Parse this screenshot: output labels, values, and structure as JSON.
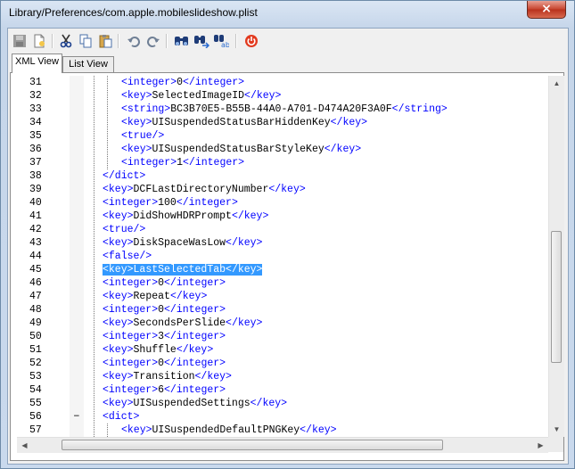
{
  "window": {
    "title": "Library/Preferences/com.apple.mobileslideshow.plist",
    "close_glyph": "×"
  },
  "toolbar": {
    "icons": [
      "save-icon",
      "new-document-icon",
      "cut-icon",
      "copy-icon",
      "paste-icon",
      "undo-icon",
      "redo-icon",
      "find-icon",
      "find-next-icon",
      "replace-icon",
      "power-icon"
    ]
  },
  "tabs": [
    {
      "label": "XML View",
      "active": true
    },
    {
      "label": "List View",
      "active": false
    }
  ],
  "editor": {
    "selected_line": 45,
    "lines": [
      {
        "n": "31",
        "indent": 2,
        "parts": [
          [
            "tag",
            "<integer>"
          ],
          [
            "txt",
            "0"
          ],
          [
            "tag",
            "</integer>"
          ]
        ]
      },
      {
        "n": "32",
        "indent": 2,
        "parts": [
          [
            "tag",
            "<key>"
          ],
          [
            "txt",
            "SelectedImageID"
          ],
          [
            "tag",
            "</key>"
          ]
        ]
      },
      {
        "n": "33",
        "indent": 2,
        "parts": [
          [
            "tag",
            "<string>"
          ],
          [
            "txt",
            "BC3B70E5-B55B-44A0-A701-D474A20F3A0F"
          ],
          [
            "tag",
            "</string>"
          ]
        ]
      },
      {
        "n": "34",
        "indent": 2,
        "parts": [
          [
            "tag",
            "<key>"
          ],
          [
            "txt",
            "UISuspendedStatusBarHiddenKey"
          ],
          [
            "tag",
            "</key>"
          ]
        ]
      },
      {
        "n": "35",
        "indent": 2,
        "parts": [
          [
            "tag",
            "<true/>"
          ]
        ]
      },
      {
        "n": "36",
        "indent": 2,
        "parts": [
          [
            "tag",
            "<key>"
          ],
          [
            "txt",
            "UISuspendedStatusBarStyleKey"
          ],
          [
            "tag",
            "</key>"
          ]
        ]
      },
      {
        "n": "37",
        "indent": 2,
        "parts": [
          [
            "tag",
            "<integer>"
          ],
          [
            "txt",
            "1"
          ],
          [
            "tag",
            "</integer>"
          ]
        ]
      },
      {
        "n": "38",
        "indent": 1,
        "parts": [
          [
            "tag",
            "</dict>"
          ]
        ]
      },
      {
        "n": "39",
        "indent": 1,
        "parts": [
          [
            "tag",
            "<key>"
          ],
          [
            "txt",
            "DCFLastDirectoryNumber"
          ],
          [
            "tag",
            "</key>"
          ]
        ]
      },
      {
        "n": "40",
        "indent": 1,
        "parts": [
          [
            "tag",
            "<integer>"
          ],
          [
            "txt",
            "100"
          ],
          [
            "tag",
            "</integer>"
          ]
        ]
      },
      {
        "n": "41",
        "indent": 1,
        "parts": [
          [
            "tag",
            "<key>"
          ],
          [
            "txt",
            "DidShowHDRPrompt"
          ],
          [
            "tag",
            "</key>"
          ]
        ]
      },
      {
        "n": "42",
        "indent": 1,
        "parts": [
          [
            "tag",
            "<true/>"
          ]
        ]
      },
      {
        "n": "43",
        "indent": 1,
        "parts": [
          [
            "tag",
            "<key>"
          ],
          [
            "txt",
            "DiskSpaceWasLow"
          ],
          [
            "tag",
            "</key>"
          ]
        ]
      },
      {
        "n": "44",
        "indent": 1,
        "parts": [
          [
            "tag",
            "<false/>"
          ]
        ]
      },
      {
        "n": "45",
        "indent": 1,
        "parts": [
          [
            "tag",
            "<key>"
          ],
          [
            "txt",
            "LastSelectedTab"
          ],
          [
            "tag",
            "</key>"
          ]
        ]
      },
      {
        "n": "46",
        "indent": 1,
        "parts": [
          [
            "tag",
            "<integer>"
          ],
          [
            "txt",
            "0"
          ],
          [
            "tag",
            "</integer>"
          ]
        ]
      },
      {
        "n": "47",
        "indent": 1,
        "parts": [
          [
            "tag",
            "<key>"
          ],
          [
            "txt",
            "Repeat"
          ],
          [
            "tag",
            "</key>"
          ]
        ]
      },
      {
        "n": "48",
        "indent": 1,
        "parts": [
          [
            "tag",
            "<integer>"
          ],
          [
            "txt",
            "0"
          ],
          [
            "tag",
            "</integer>"
          ]
        ]
      },
      {
        "n": "49",
        "indent": 1,
        "parts": [
          [
            "tag",
            "<key>"
          ],
          [
            "txt",
            "SecondsPerSlide"
          ],
          [
            "tag",
            "</key>"
          ]
        ]
      },
      {
        "n": "50",
        "indent": 1,
        "parts": [
          [
            "tag",
            "<integer>"
          ],
          [
            "txt",
            "3"
          ],
          [
            "tag",
            "</integer>"
          ]
        ]
      },
      {
        "n": "51",
        "indent": 1,
        "parts": [
          [
            "tag",
            "<key>"
          ],
          [
            "txt",
            "Shuffle"
          ],
          [
            "tag",
            "</key>"
          ]
        ]
      },
      {
        "n": "52",
        "indent": 1,
        "parts": [
          [
            "tag",
            "<integer>"
          ],
          [
            "txt",
            "0"
          ],
          [
            "tag",
            "</integer>"
          ]
        ]
      },
      {
        "n": "53",
        "indent": 1,
        "parts": [
          [
            "tag",
            "<key>"
          ],
          [
            "txt",
            "Transition"
          ],
          [
            "tag",
            "</key>"
          ]
        ]
      },
      {
        "n": "54",
        "indent": 1,
        "parts": [
          [
            "tag",
            "<integer>"
          ],
          [
            "txt",
            "6"
          ],
          [
            "tag",
            "</integer>"
          ]
        ]
      },
      {
        "n": "55",
        "indent": 1,
        "parts": [
          [
            "tag",
            "<key>"
          ],
          [
            "txt",
            "UISuspendedSettings"
          ],
          [
            "tag",
            "</key>"
          ]
        ]
      },
      {
        "n": "56",
        "indent": 1,
        "fold": "−",
        "parts": [
          [
            "tag",
            "<dict>"
          ]
        ]
      },
      {
        "n": "57",
        "indent": 2,
        "parts": [
          [
            "tag",
            "<key>"
          ],
          [
            "txt",
            "UISuspendedDefaultPNGKey"
          ],
          [
            "tag",
            "</key>"
          ]
        ]
      }
    ]
  }
}
